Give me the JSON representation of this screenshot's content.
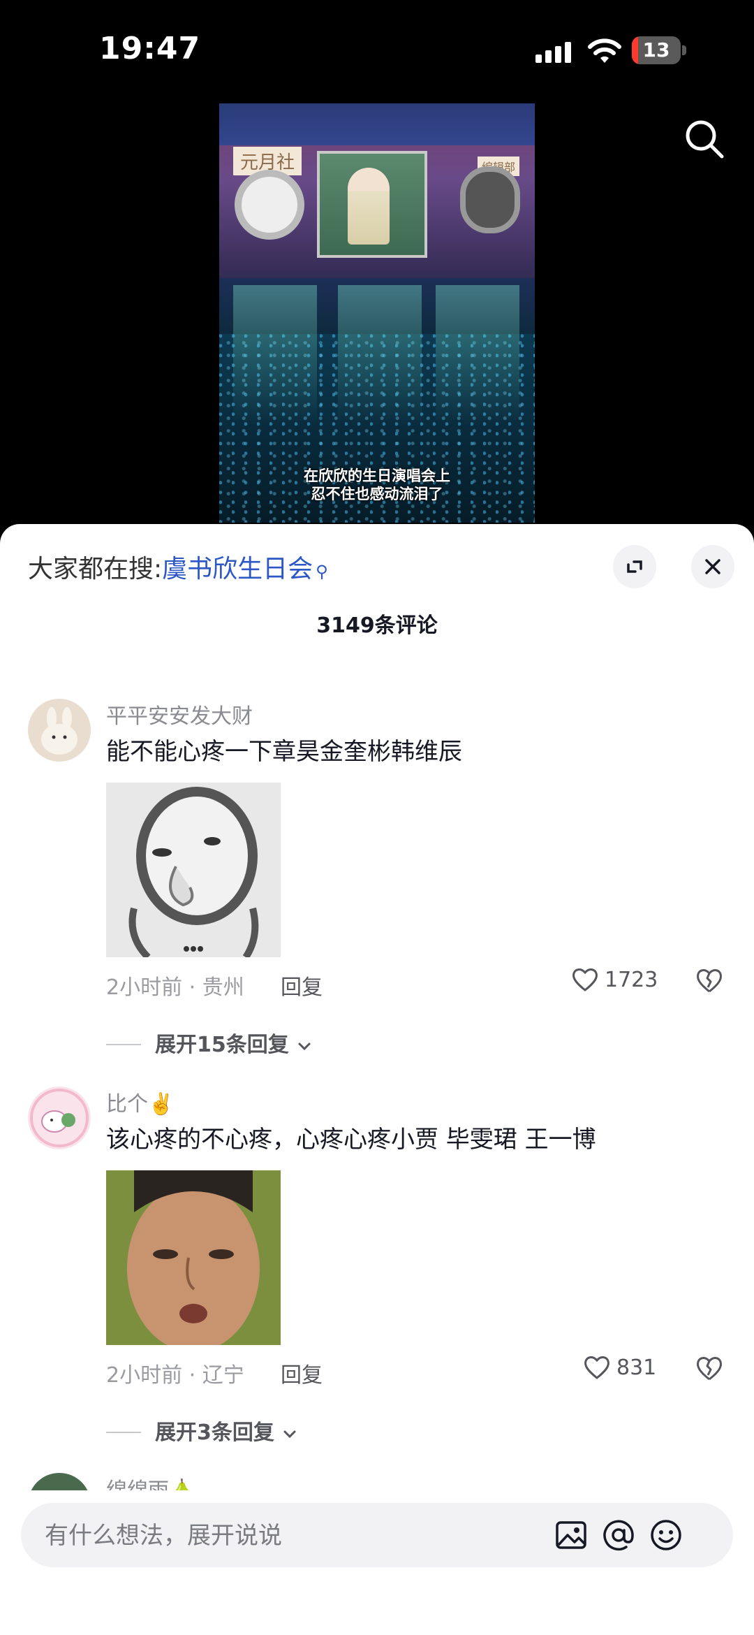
{
  "status_bar": {
    "time": "19:47",
    "battery": "13"
  },
  "video": {
    "sign_left": "元月社",
    "sign_right": "编辑部",
    "subtitle_line1": "在欣欣的生日演唱会上",
    "subtitle_line2": "忍不住也感动流泪了"
  },
  "panel": {
    "everyone_searching_label": "大家都在搜:",
    "search_keyword": "虞书欣生日会",
    "comment_count": "3149条评论"
  },
  "comments": [
    {
      "username": "平平安安发大财",
      "text": "能不能心疼一下章昊金奎彬韩维辰",
      "meta": "2小时前 · 贵州",
      "reply_label": "回复",
      "likes": "1723",
      "expand_label": "展开15条回复"
    },
    {
      "username": "比个✌️",
      "text": "该心疼的不心疼，心疼心疼小贾 毕雯珺 王一博",
      "meta": "2小时前 · 辽宁",
      "reply_label": "回复",
      "likes": "831",
      "expand_label": "展开3条回复"
    },
    {
      "username": "绵绵雨🍐"
    }
  ],
  "input": {
    "placeholder": "有什么想法，展开说说"
  },
  "colors": {
    "keyword": "#2c57c4",
    "battery_low": "#ff3b30"
  }
}
